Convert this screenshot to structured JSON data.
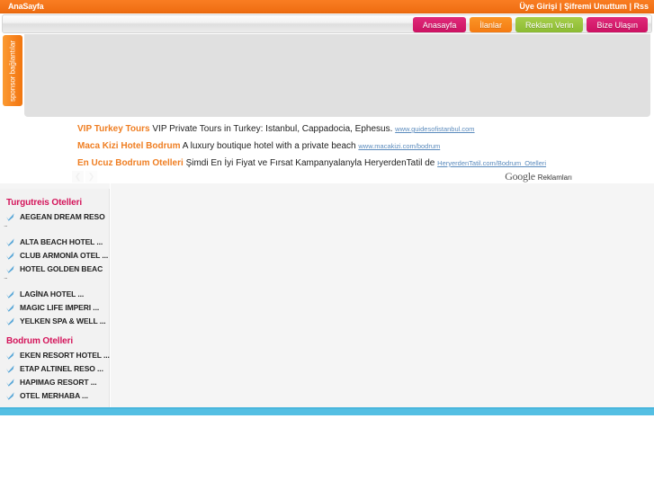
{
  "topbar": {
    "home_label": "AnaSayfa",
    "links": [
      {
        "label": "Üye Girişi"
      },
      {
        "label": "Şifremi Unuttum"
      },
      {
        "label": "Rss"
      }
    ],
    "separator": " | "
  },
  "nav": {
    "buttons": [
      {
        "label": "Anasayfa",
        "color": "#cc1262",
        "style": "pink"
      },
      {
        "label": "İlanlar",
        "color": "#f47b12",
        "style": "orange"
      },
      {
        "label": "Reklam Verin",
        "color": "#8cbb33",
        "style": "green"
      },
      {
        "label": "Bize Ulaşın",
        "color": "#cc1262",
        "style": "pink"
      }
    ]
  },
  "sponsor": {
    "tab_label": "sponsor bağlantılar"
  },
  "banner": {
    "placeholder": ""
  },
  "ads": {
    "items": [
      {
        "title": "VIP Turkey Tours",
        "description": "VIP Private Tours in Turkey: Istanbul, Cappadocia, Ephesus.",
        "url": "www.guidesofistanbul.com"
      },
      {
        "title": "Maca Kizi Hotel Bodrum",
        "description": "A luxury boutique hotel with a private beach",
        "url": "www.macakizi.com/bodrum"
      },
      {
        "title": "En Ucuz Bodrum Otelleri",
        "description": "Şimdi En İyi Fiyat ve Fırsat Kampanyalanyla HeryerdenTatil de",
        "url": "HeryerdenTatil.com/Bodrum_Otelleri"
      }
    ],
    "prev_arrow": "❮",
    "next_arrow": "❯",
    "google_logo": "Google",
    "google_label": "Reklamları"
  },
  "hotel_lists": [
    {
      "heading": "Turgutreis Otelleri",
      "items": [
        {
          "label": "AEGEAN DREAM RESO",
          "gap_after": true
        },
        {
          "label": "ALTA BEACH HOTEL ...",
          "gap_after": false
        },
        {
          "label": "CLUB ARMONİA OTEL ...",
          "gap_after": false
        },
        {
          "label": "HOTEL GOLDEN BEAC",
          "gap_after": true
        },
        {
          "label": "LAGİNA HOTEL ...",
          "gap_after": false
        },
        {
          "label": "MAGIC LIFE IMPERI ...",
          "gap_after": false
        },
        {
          "label": "YELKEN SPA & WELL ...",
          "gap_after": false
        }
      ]
    },
    {
      "heading": "Bodrum Otelleri",
      "items": [
        {
          "label": "EKEN RESORT HOTEL ...",
          "gap_after": false
        },
        {
          "label": "ETAP ALTINEL RESO ...",
          "gap_after": false
        },
        {
          "label": "HAPIMAG RESORT ...",
          "gap_after": false
        },
        {
          "label": "OTEL MERHABA ...",
          "gap_after": false
        }
      ]
    }
  ],
  "colors": {
    "brand_orange": "#f4751a",
    "accent_pink": "#d4145a",
    "accent_green": "#8cbb33",
    "footer_blue": "#54bfe3",
    "ad_title_orange": "#ef7e22",
    "ad_link_blue": "#5b8bbd"
  }
}
